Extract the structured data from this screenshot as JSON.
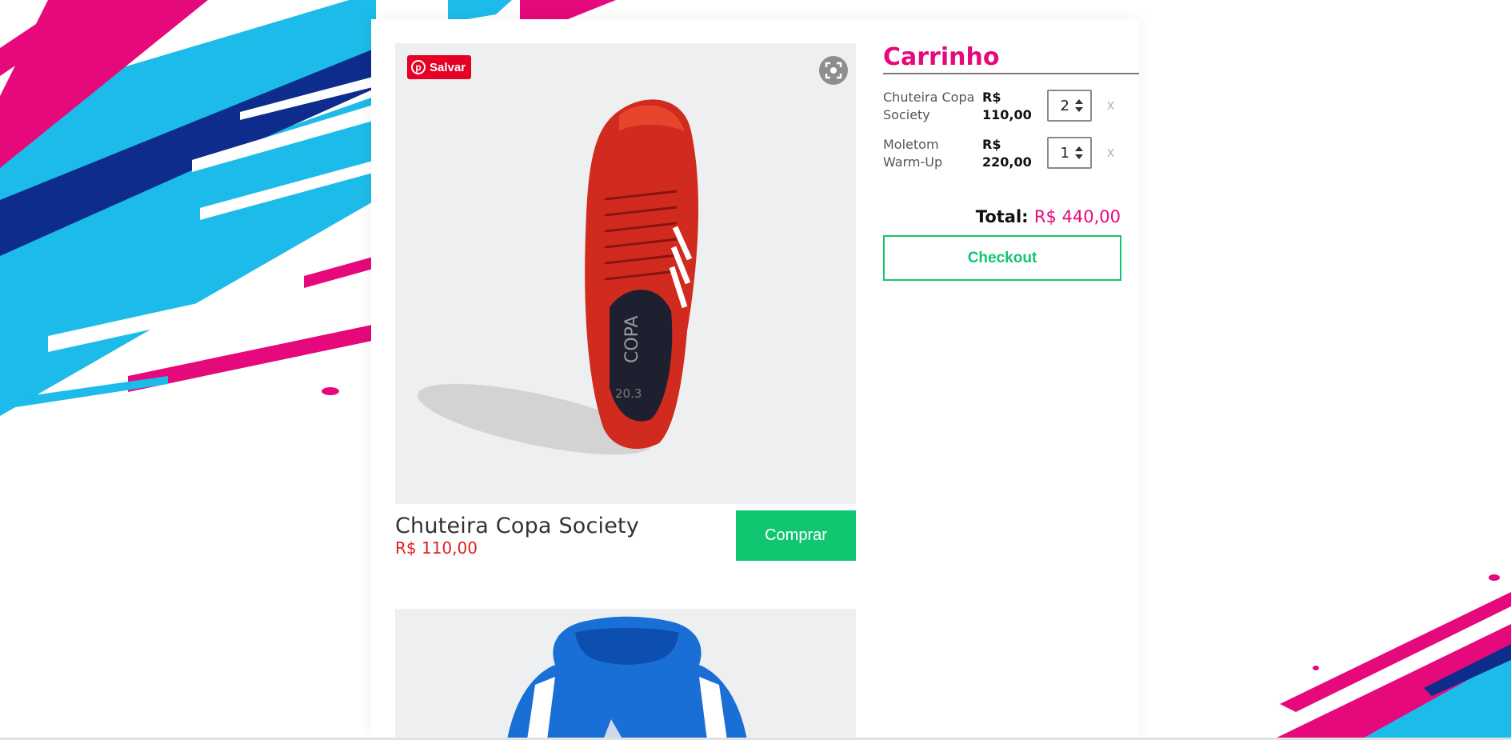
{
  "colors": {
    "brand_pink": "#e5097b",
    "buy_green": "#11c671",
    "price_red": "#e02020",
    "stripe_blue": "#1cbbe9",
    "stripe_navy": "#0d2c8c",
    "pinterest_red": "#e60023"
  },
  "pinterest": {
    "save_label": "Salvar",
    "icon": "pinterest-icon"
  },
  "lens": {
    "icon": "visual-search-icon"
  },
  "products": [
    {
      "name": "Chuteira Copa Society",
      "price": "R$ 110,00",
      "button": "Comprar",
      "image": "red-football-boot",
      "image_text": "COPA 20.3"
    },
    {
      "name": "",
      "price": "",
      "button": "",
      "image": "blue-hoodie"
    }
  ],
  "cart": {
    "title": "Carrinho",
    "items": [
      {
        "name": "Chuteira Copa Society",
        "price": "R$ 110,00",
        "qty": "2",
        "remove": "x"
      },
      {
        "name": "Moletom Warm-Up",
        "price": "R$ 220,00",
        "qty": "1",
        "remove": "x"
      }
    ],
    "total_label": "Total:",
    "total_value": "R$ 440,00",
    "checkout_label": "Checkout"
  }
}
